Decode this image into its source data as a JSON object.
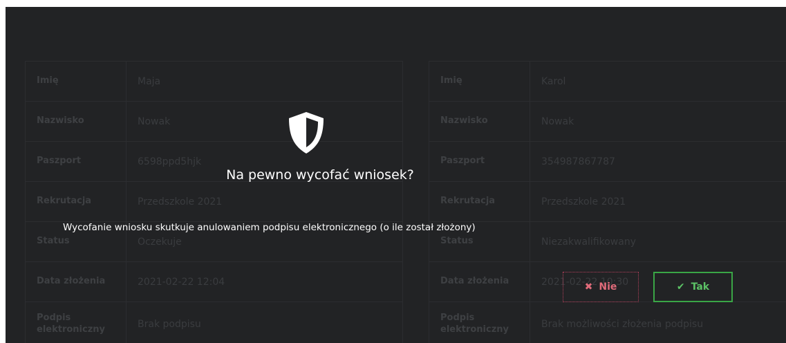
{
  "background": {
    "left_card": {
      "rows": [
        {
          "label": "Imię",
          "value": "Maja"
        },
        {
          "label": "Nazwisko",
          "value": "Nowak"
        },
        {
          "label": "Paszport",
          "value": "6598ppd5hjk"
        },
        {
          "label": "Rekrutacja",
          "value": "Przedszkole 2021"
        },
        {
          "label": "Status",
          "value": "Oczekuje"
        },
        {
          "label": "Data złożenia",
          "value": "2021-02-22 12:04"
        },
        {
          "label": "Podpis elektroniczny",
          "value": "Brak podpisu"
        }
      ]
    },
    "right_card": {
      "rows": [
        {
          "label": "Imię",
          "value": "Karol"
        },
        {
          "label": "Nazwisko",
          "value": "Nowak"
        },
        {
          "label": "Paszport",
          "value": "354987867787"
        },
        {
          "label": "Rekrutacja",
          "value": "Przedszkole 2021"
        },
        {
          "label": "Status",
          "value": "Niezakwalifikowany"
        },
        {
          "label": "Data złożenia",
          "value": "2021-02-22 10:30"
        },
        {
          "label": "Podpis elektroniczny",
          "value": "Brak możliwości złożenia podpisu"
        }
      ]
    }
  },
  "dialog": {
    "icon": "shield-icon",
    "title": "Na pewno wycofać wniosek?",
    "message": "Wycofanie wniosku skutkuje anulowaniem podpisu elektronicznego (o ile został złożony)",
    "buttons": {
      "no": {
        "label": "Nie",
        "icon": "x-icon",
        "color": "#e06b7a"
      },
      "yes": {
        "label": "Tak",
        "icon": "check-icon",
        "color": "#5cc266"
      }
    }
  },
  "colors": {
    "overlay": "#222325",
    "text": "#ffffff"
  }
}
